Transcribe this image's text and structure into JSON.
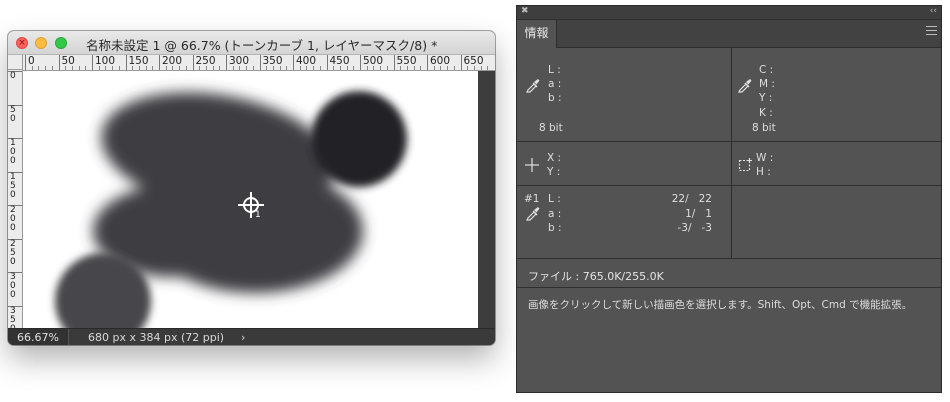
{
  "document_window": {
    "title": "名称未設定 1 @ 66.7% (トーンカーブ 1, レイヤーマスク/8) *",
    "close_glyph": "×",
    "ruler_h_labels": [
      "0",
      "50",
      "100",
      "150",
      "200",
      "250",
      "300",
      "350",
      "400",
      "450",
      "500",
      "550",
      "600",
      "650"
    ],
    "ruler_v_labels": [
      "0",
      "50",
      "100",
      "150",
      "200",
      "250",
      "300",
      "350"
    ],
    "cursor_sample_number": "1",
    "shape_colors": {
      "main": "#3d3d42",
      "small_circle": "#47474c",
      "top_circle": "#232326"
    },
    "status": {
      "zoom": "66.67%",
      "doc_size": "680 px x 384 px (72 ppi)",
      "arrow": "›"
    }
  },
  "info_panel": {
    "close_icon": "✖",
    "collapse_icon": "‹‹",
    "tab_label": "情報",
    "lab": {
      "l_label": "L :",
      "a_label": "a :",
      "b_label": "b :",
      "bit": "8 bit"
    },
    "cmyk": {
      "c_label": "C :",
      "m_label": "M :",
      "y_label": "Y :",
      "k_label": "K :",
      "bit": "8 bit"
    },
    "position": {
      "x_label": "X :",
      "y_label": "Y :"
    },
    "size": {
      "w_label": "W :",
      "h_label": "H :"
    },
    "sampler": {
      "id": "#1",
      "l_label": "L :",
      "l_value": "22/   22",
      "a_label": "a :",
      "a_value": "1/   1",
      "b_label": "b :",
      "b_value": "-3/   -3"
    },
    "file_info": "ファイル : 765.0K/255.0K",
    "hint": "画像をクリックして新しい描画色を選択します。Shift、Opt、Cmd で機能拡張。"
  }
}
